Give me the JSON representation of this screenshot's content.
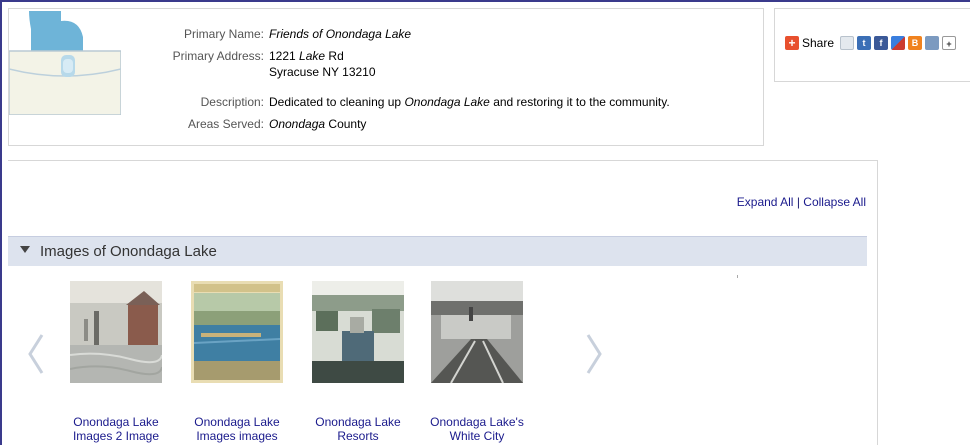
{
  "org": {
    "primary_name_label": "Primary Name:",
    "primary_name": "Friends of Onondaga Lake",
    "primary_address_label": "Primary Address:",
    "address_line1_num": "1221",
    "address_line1_em": "Lake",
    "address_line1_rest": "Rd",
    "address_line2": "Syracuse NY 13210",
    "description_label": "Description:",
    "description_pre": "Dedicated to cleaning up",
    "description_em": "Onondaga Lake",
    "description_post": "and restoring it to the community.",
    "areas_served_label": "Areas Served:",
    "areas_served_em": "Onondaga",
    "areas_served_rest": "County"
  },
  "share": {
    "label": "Share",
    "icons": [
      "email-icon",
      "twitter-icon",
      "facebook-icon",
      "delicious-icon",
      "blogger-icon",
      "myspace-icon",
      "more-icon"
    ]
  },
  "panel": {
    "expand_all": "Expand All",
    "separator": "|",
    "collapse_all": "Collapse All",
    "section_title": "Images of Onondaga Lake"
  },
  "thumbnails": [
    {
      "line1": "Onondaga Lake",
      "line2": "Images 2 Image"
    },
    {
      "line1": "Onondaga Lake",
      "line2": "Images images"
    },
    {
      "line1": "Onondaga Lake",
      "line2": "Resorts"
    },
    {
      "line1": "Onondaga Lake's",
      "line2": "White City"
    }
  ],
  "colors": {
    "link": "#1a1a8c",
    "section_header_bg": "#dde3ee",
    "share_plus": "#e8502e"
  }
}
